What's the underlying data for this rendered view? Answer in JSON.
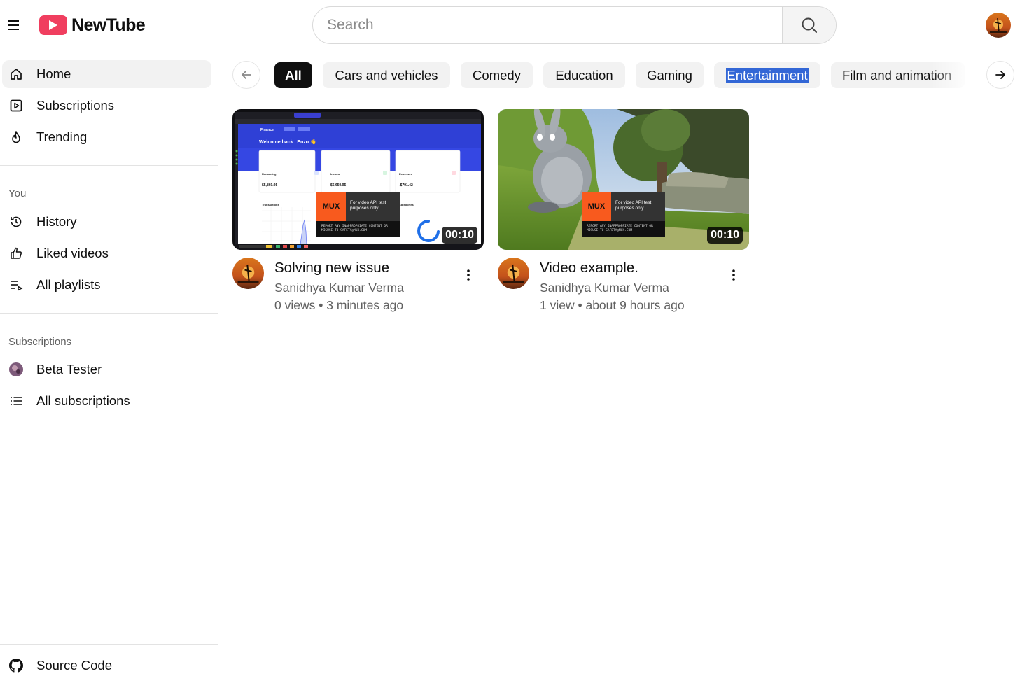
{
  "header": {
    "logo_text": "NewTube",
    "search_placeholder": "Search",
    "menu_icon": "hamburger-menu-icon",
    "search_icon": "search-icon"
  },
  "sidebar": {
    "main": [
      {
        "label": "Home",
        "icon": "home-icon",
        "active": true
      },
      {
        "label": "Subscriptions",
        "icon": "subscriptions-icon",
        "active": false
      },
      {
        "label": "Trending",
        "icon": "flame-icon",
        "active": false
      }
    ],
    "you_heading": "You",
    "you": [
      {
        "label": "History",
        "icon": "history-icon"
      },
      {
        "label": "Liked videos",
        "icon": "thumbs-up-icon"
      },
      {
        "label": "All playlists",
        "icon": "playlist-icon"
      }
    ],
    "subscriptions_heading": "Subscriptions",
    "subscriptions": [
      {
        "label": "Beta Tester",
        "icon": "channel-avatar"
      },
      {
        "label": "All subscriptions",
        "icon": "list-icon"
      }
    ],
    "footer": {
      "label": "Source Code",
      "icon": "github-icon"
    }
  },
  "categories": [
    {
      "label": "All",
      "active": true
    },
    {
      "label": "Cars and vehicles"
    },
    {
      "label": "Comedy"
    },
    {
      "label": "Education"
    },
    {
      "label": "Gaming"
    },
    {
      "label": "Entertainment",
      "highlighted": true
    },
    {
      "label": "Film and animation"
    }
  ],
  "videos": [
    {
      "title": "Solving new issue",
      "channel": "Sanidhya Kumar Verma",
      "views": "0 views",
      "age": "3 minutes ago",
      "duration": "00:10",
      "thumb": {
        "app": "Finance",
        "greeting": "Welcome back , Enzo 👋",
        "cards": [
          {
            "label": "Remaining",
            "value": "$5,869.95"
          },
          {
            "label": "Income",
            "value": "$6,650.95"
          },
          {
            "label": "Expenses",
            "value": "-$791.42"
          }
        ],
        "section": "Transactions",
        "section2": "Categories"
      }
    },
    {
      "title": "Video example.",
      "channel": "Sanidhya Kumar Verma",
      "views": "1 view",
      "age": "about 9 hours ago",
      "duration": "00:10"
    }
  ],
  "overlay": {
    "logo": "MUX",
    "text": "For video API test purposes only",
    "footer": "REPORT ANY INAPPROPRIATE CONTENT OR MISUSE TO SAFETY@MUX.COM"
  },
  "colors": {
    "brand": "#f03e5f",
    "chip_active": "#0f0f0f",
    "selection": "#3367d6",
    "secondary_text": "#606060"
  }
}
